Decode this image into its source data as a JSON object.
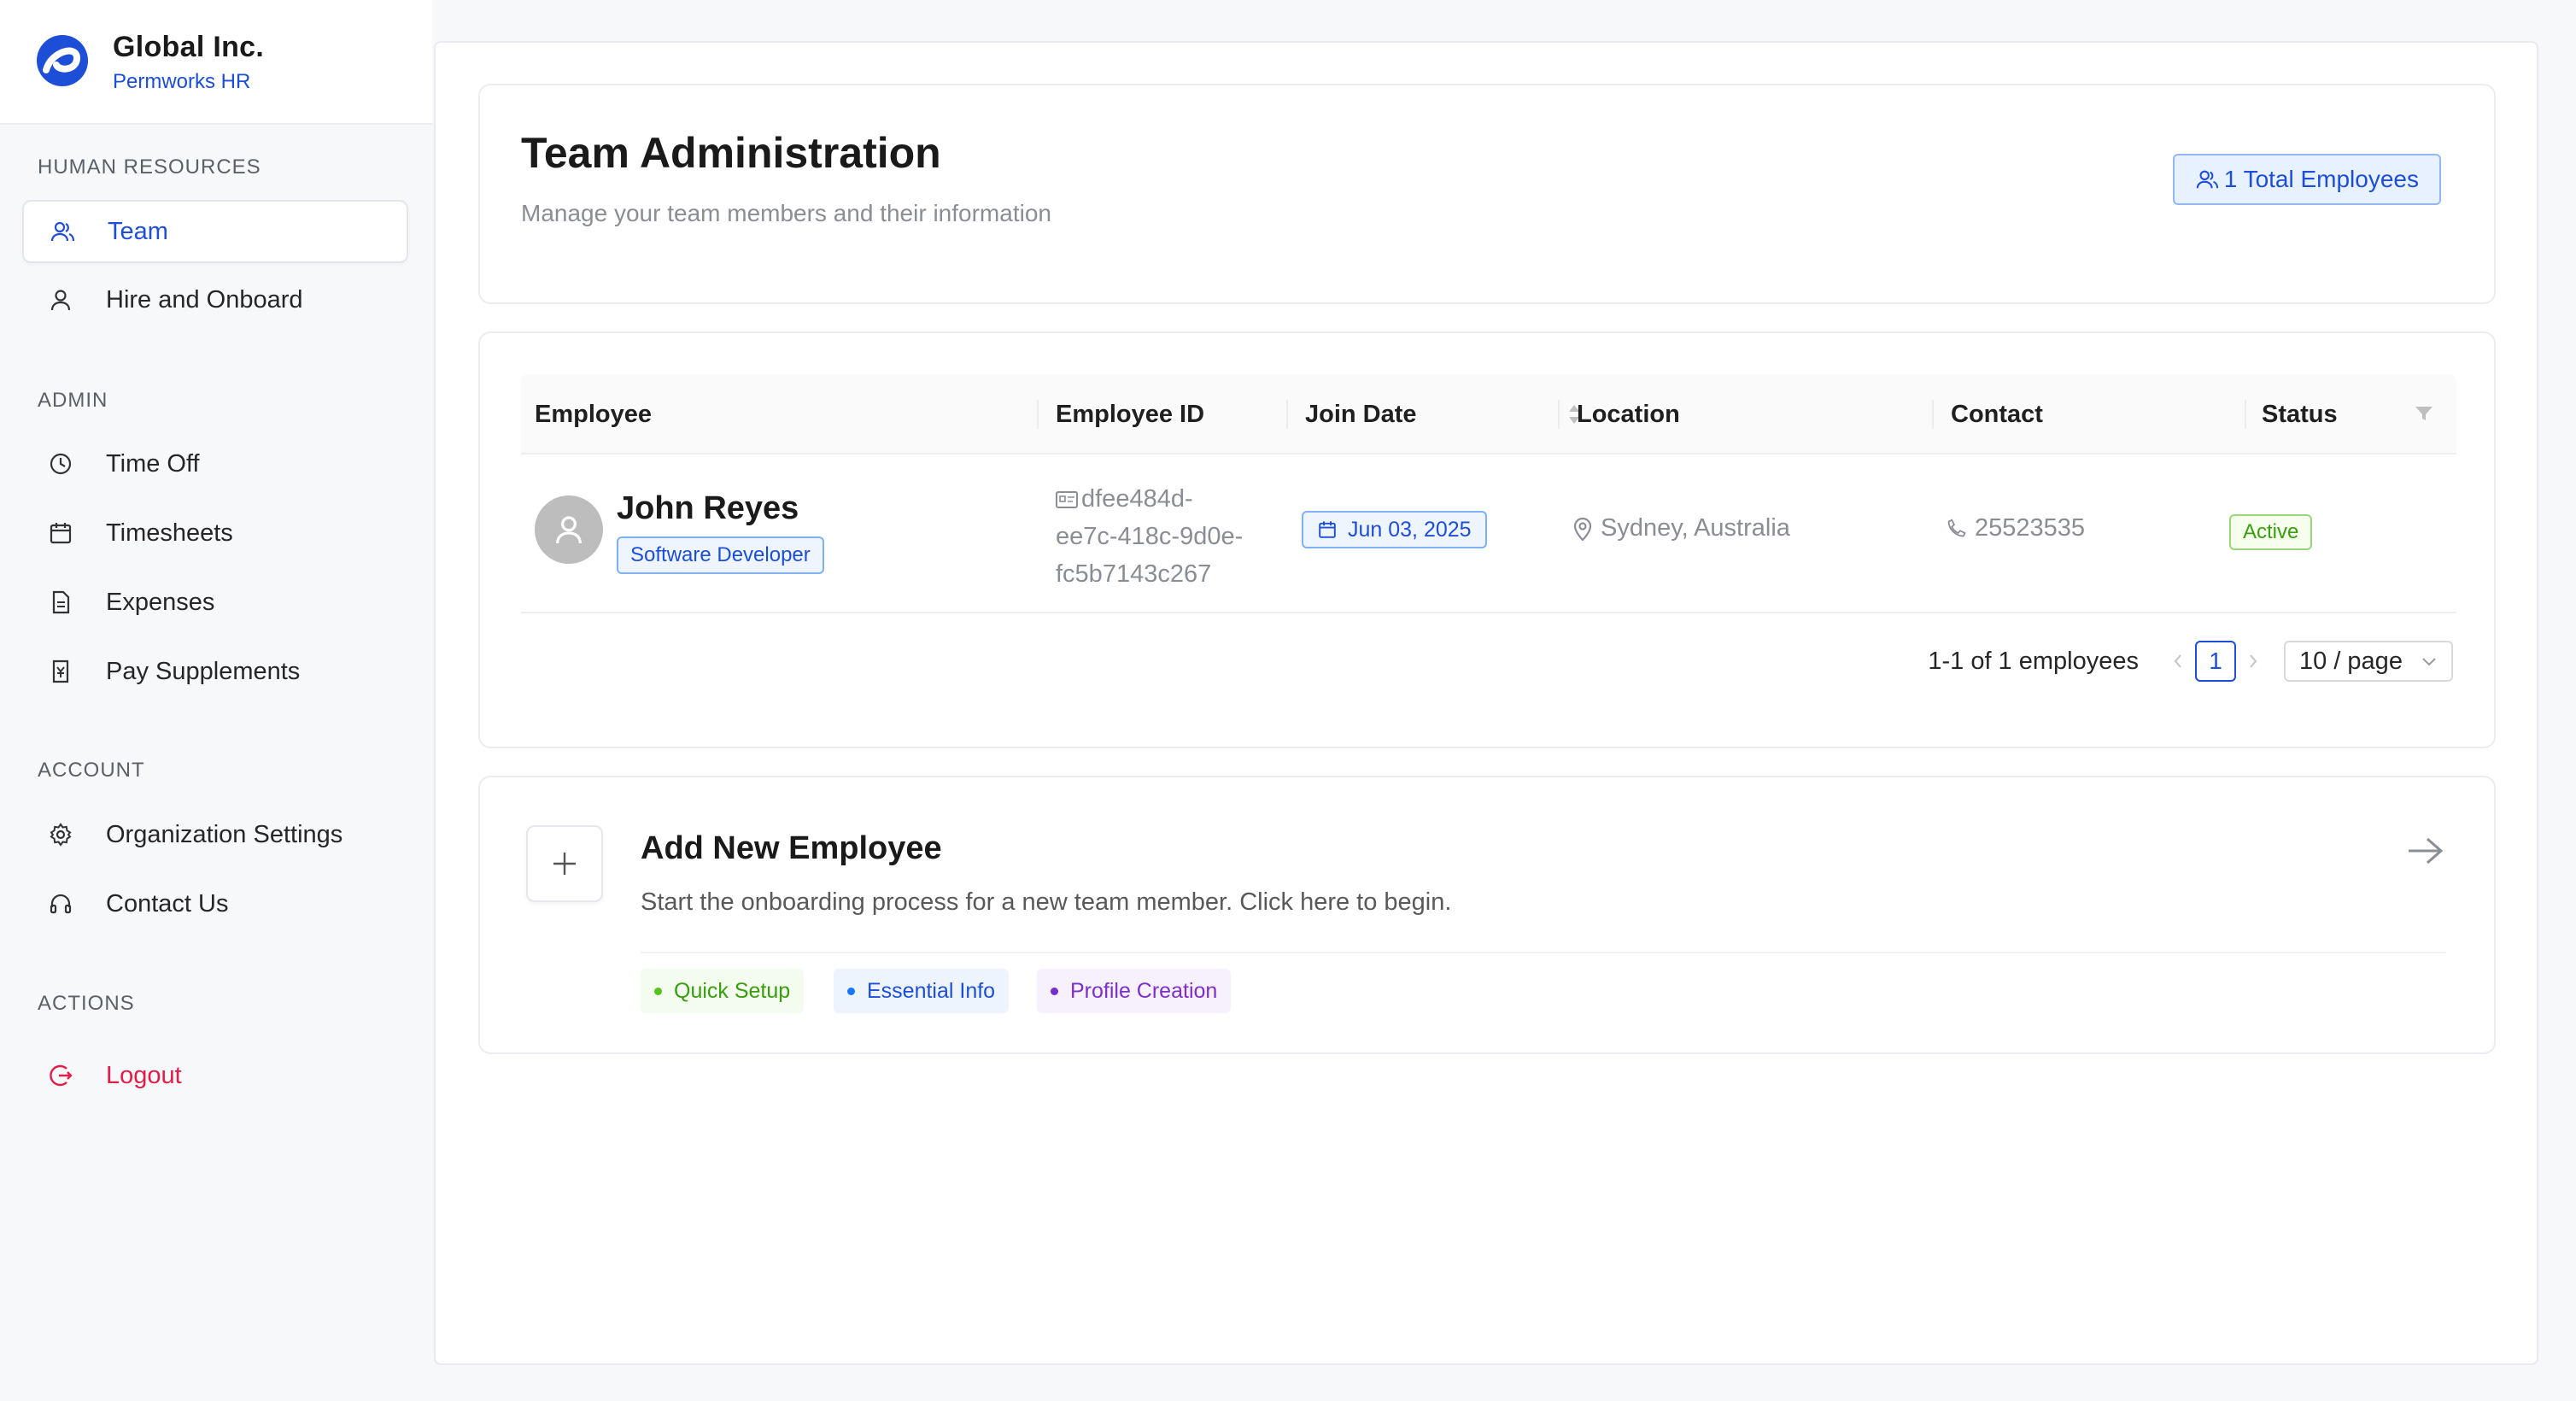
{
  "brand": {
    "name": "Global Inc.",
    "subtitle": "Permworks HR"
  },
  "sidebar": {
    "sections": [
      {
        "title": "HUMAN RESOURCES",
        "items": [
          {
            "label": "Team",
            "icon": "team-icon",
            "active": true
          },
          {
            "label": "Hire and Onboard",
            "icon": "user-icon"
          }
        ]
      },
      {
        "title": "ADMIN",
        "items": [
          {
            "label": "Time Off",
            "icon": "clock-icon"
          },
          {
            "label": "Timesheets",
            "icon": "calendar-icon"
          },
          {
            "label": "Expenses",
            "icon": "document-icon"
          },
          {
            "label": "Pay Supplements",
            "icon": "money-icon"
          }
        ]
      },
      {
        "title": "ACCOUNT",
        "items": [
          {
            "label": "Organization Settings",
            "icon": "gear-icon"
          },
          {
            "label": "Contact Us",
            "icon": "headset-icon"
          }
        ]
      },
      {
        "title": "ACTIONS",
        "items": [
          {
            "label": "Logout",
            "icon": "logout-icon"
          }
        ]
      }
    ]
  },
  "header": {
    "title": "Team Administration",
    "subtitle": "Manage your team members and their information",
    "total_badge": "1 Total Employees"
  },
  "table": {
    "columns": [
      "Employee",
      "Employee ID",
      "Join Date",
      "Location",
      "Contact",
      "Status"
    ],
    "rows": [
      {
        "name": "John Reyes",
        "role": "Software Developer",
        "employee_id": [
          "dfee484d-",
          "ee7c-418c-9d0e-",
          "fc5b7143c267"
        ],
        "join_date": "Jun 03, 2025",
        "location": "Sydney, Australia",
        "contact": "25523535",
        "status": "Active"
      }
    ],
    "pagination": {
      "summary": "1-1 of 1 employees",
      "current_page": "1",
      "page_size": "10 / page"
    }
  },
  "add_employee": {
    "title": "Add New Employee",
    "description": "Start the onboarding process for a new team member. Click here to begin.",
    "chips": [
      {
        "label": "Quick Setup",
        "color": "#389e0d",
        "bg": "#f4fbef",
        "dot": "#52c41a"
      },
      {
        "label": "Essential Info",
        "color": "#1d4ed8",
        "bg": "#eef4fe",
        "dot": "#1677ff"
      },
      {
        "label": "Profile Creation",
        "color": "#7c2fc9",
        "bg": "#f7f1fd",
        "dot": "#722ed1"
      }
    ]
  },
  "colors": {
    "accent": "#1d4ed8",
    "danger": "#e11d48",
    "success": "#389e0d"
  }
}
